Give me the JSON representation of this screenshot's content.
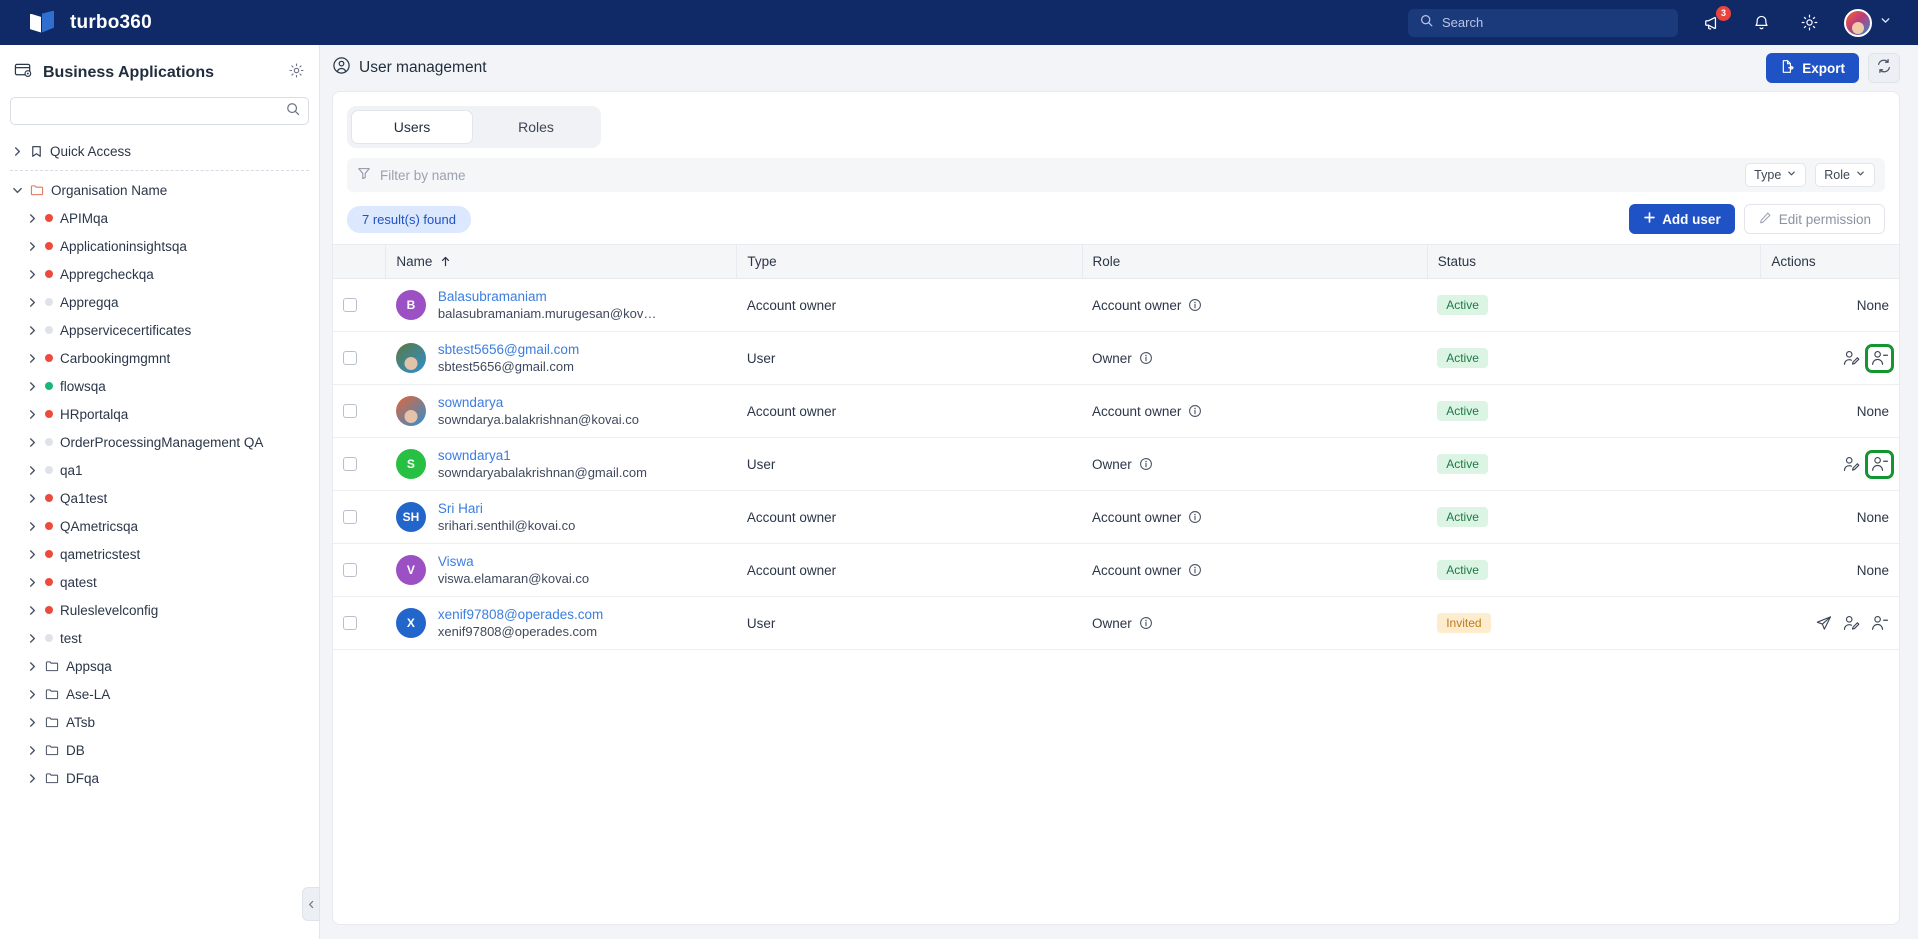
{
  "topbar": {
    "brand": "turbo360",
    "search_placeholder": "Search",
    "announce_badge": "3",
    "icons": {
      "announce": "megaphone-icon",
      "bell": "bell-icon",
      "gear": "gear-icon"
    }
  },
  "sidebar": {
    "title": "Business Applications",
    "search_value": "",
    "search_placeholder": "",
    "tree": [
      {
        "label": "Quick Access",
        "level": 0,
        "icon": "bookmark",
        "expanded": false,
        "dot": null
      },
      {
        "divider": true
      },
      {
        "label": "Organisation Name",
        "level": 0,
        "icon": "folder-open",
        "expanded": true,
        "dot": null
      },
      {
        "label": "APIMqa",
        "level": 1,
        "icon": "dot",
        "expanded": false,
        "dot": "#ec4b3c"
      },
      {
        "label": "Applicationinsightsqa",
        "level": 1,
        "icon": "dot",
        "expanded": false,
        "dot": "#ec4b3c"
      },
      {
        "label": "Appregcheckqa",
        "level": 1,
        "icon": "dot",
        "expanded": false,
        "dot": "#ec4b3c"
      },
      {
        "label": "Appregqa",
        "level": 1,
        "icon": "dot",
        "expanded": false,
        "dot": "#dfe2e8"
      },
      {
        "label": "Appservicecertificates",
        "level": 1,
        "icon": "dot",
        "expanded": false,
        "dot": "#dfe2e8"
      },
      {
        "label": "Carbookingmgmnt",
        "level": 1,
        "icon": "dot",
        "expanded": false,
        "dot": "#ec4b3c"
      },
      {
        "label": "flowsqa",
        "level": 1,
        "icon": "dot",
        "expanded": false,
        "dot": "#18b67a"
      },
      {
        "label": "HRportalqa",
        "level": 1,
        "icon": "dot",
        "expanded": false,
        "dot": "#ec4b3c"
      },
      {
        "label": "OrderProcessingManagement QA",
        "level": 1,
        "icon": "dot",
        "expanded": false,
        "dot": "#dfe2e8"
      },
      {
        "label": "qa1",
        "level": 1,
        "icon": "dot",
        "expanded": false,
        "dot": "#dfe2e8"
      },
      {
        "label": "Qa1test",
        "level": 1,
        "icon": "dot",
        "expanded": false,
        "dot": "#ec4b3c"
      },
      {
        "label": "QAmetricsqa",
        "level": 1,
        "icon": "dot",
        "expanded": false,
        "dot": "#ec4b3c"
      },
      {
        "label": "qametricstest",
        "level": 1,
        "icon": "dot",
        "expanded": false,
        "dot": "#ec4b3c"
      },
      {
        "label": "qatest",
        "level": 1,
        "icon": "dot",
        "expanded": false,
        "dot": "#ec4b3c"
      },
      {
        "label": "Ruleslevelconfig",
        "level": 1,
        "icon": "dot",
        "expanded": false,
        "dot": "#ec4b3c"
      },
      {
        "label": "test",
        "level": 1,
        "icon": "dot",
        "expanded": false,
        "dot": "#dfe2e8"
      },
      {
        "label": "Appsqa",
        "level": 1,
        "icon": "folder",
        "expanded": false,
        "dot": null
      },
      {
        "label": "Ase-LA",
        "level": 1,
        "icon": "folder",
        "expanded": false,
        "dot": null
      },
      {
        "label": "ATsb",
        "level": 1,
        "icon": "folder",
        "expanded": false,
        "dot": null
      },
      {
        "label": "DB",
        "level": 1,
        "icon": "folder",
        "expanded": false,
        "dot": null
      },
      {
        "label": "DFqa",
        "level": 1,
        "icon": "folder",
        "expanded": false,
        "dot": null
      }
    ]
  },
  "main": {
    "page_title": "User management",
    "export_label": "Export",
    "refresh_icon": "refresh-icon",
    "tabs": [
      {
        "label": "Users",
        "active": true
      },
      {
        "label": "Roles",
        "active": false
      }
    ],
    "filter_placeholder": "Filter by name",
    "filter_value": "",
    "type_select": "Type",
    "role_select": "Role",
    "result_count": "7 result(s) found",
    "add_user_label": "Add user",
    "edit_permission_label": "Edit permission",
    "columns": [
      "Name",
      "Type",
      "Role",
      "Status",
      "Actions"
    ],
    "sort_column": "Name",
    "sort_direction": "asc",
    "rows": [
      {
        "name": "Balasubramaniam",
        "email": "balasubramaniam.murugesan@kov…",
        "avatar_text": "B",
        "avatar_color": "#9b51c4",
        "avatar_photo": false,
        "type": "Account owner",
        "role": "Account owner",
        "status": "Active",
        "status_kind": "active",
        "actions": "None",
        "action_icons": []
      },
      {
        "name": "sbtest5656@gmail.com",
        "email": "sbtest5656@gmail.com",
        "avatar_text": "",
        "avatar_color": "#5a7a42",
        "avatar_photo": true,
        "type": "User",
        "role": "Owner",
        "status": "Active",
        "status_kind": "active",
        "actions": "",
        "action_icons": [
          "edit-user-icon",
          "remove-user-icon"
        ],
        "highlight_last": true
      },
      {
        "name": "sowndarya",
        "email": "sowndarya.balakrishnan@kovai.co",
        "avatar_text": "",
        "avatar_color": "#e2663a",
        "avatar_photo": true,
        "type": "Account owner",
        "role": "Account owner",
        "status": "Active",
        "status_kind": "active",
        "actions": "None",
        "action_icons": []
      },
      {
        "name": "sowndarya1",
        "email": "sowndaryabalakrishnan@gmail.com",
        "avatar_text": "S",
        "avatar_color": "#27c043",
        "avatar_photo": false,
        "type": "User",
        "role": "Owner",
        "status": "Active",
        "status_kind": "active",
        "actions": "",
        "action_icons": [
          "edit-user-icon",
          "remove-user-icon"
        ],
        "highlight_last": true
      },
      {
        "name": "Sri Hari",
        "email": "srihari.senthil@kovai.co",
        "avatar_text": "SH",
        "avatar_color": "#2266cc",
        "avatar_photo": false,
        "type": "Account owner",
        "role": "Account owner",
        "status": "Active",
        "status_kind": "active",
        "actions": "None",
        "action_icons": []
      },
      {
        "name": "Viswa",
        "email": "viswa.elamaran@kovai.co",
        "avatar_text": "V",
        "avatar_color": "#9b51c4",
        "avatar_photo": false,
        "type": "Account owner",
        "role": "Account owner",
        "status": "Active",
        "status_kind": "active",
        "actions": "None",
        "action_icons": []
      },
      {
        "name": "xenif97808@operades.com",
        "email": "xenif97808@operades.com",
        "avatar_text": "X",
        "avatar_color": "#2266cc",
        "avatar_photo": false,
        "type": "User",
        "role": "Owner",
        "status": "Invited",
        "status_kind": "invited",
        "actions": "",
        "action_icons": [
          "resend-invite-icon",
          "edit-user-icon",
          "remove-user-icon"
        ],
        "highlight_last": false
      }
    ]
  },
  "colors": {
    "brand_navy": "#102a68",
    "accent_blue": "#1f52c4",
    "link_blue": "#3b7de0",
    "active_green": "#1d7a45",
    "invited_amber": "#c07c19",
    "highlight_green": "#13962f"
  }
}
